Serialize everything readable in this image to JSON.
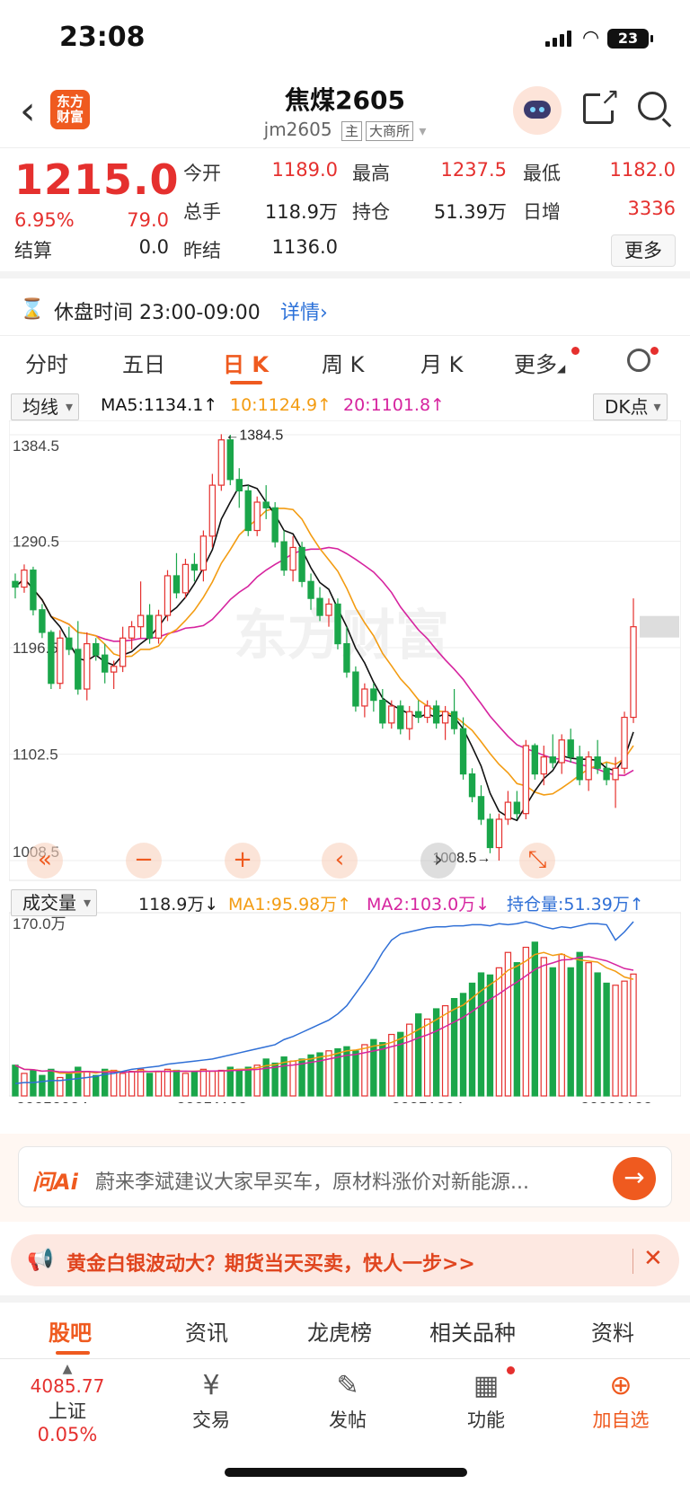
{
  "status": {
    "time": "23:08",
    "battery": "23"
  },
  "header": {
    "logo_text": "东方\n财富",
    "title": "焦煤2605",
    "code": "jm2605",
    "tag_main": "主",
    "tag_exchange": "大商所"
  },
  "quote": {
    "price": "1215.0",
    "change_pct": "6.95%",
    "change_val": "79.0",
    "open_label": "今开",
    "open": "1189.0",
    "high_label": "最高",
    "high": "1237.5",
    "low_label": "最低",
    "low": "1182.0",
    "vol_label": "总手",
    "vol": "118.9万",
    "oi_label": "持仓",
    "oi": "51.39万",
    "daily_inc_label": "日增",
    "daily_inc": "3336",
    "settle_label": "结算",
    "settle": "0.0",
    "prev_settle_label": "昨结",
    "prev_settle": "1136.0",
    "more": "更多"
  },
  "session": {
    "text": "休盘时间 23:00-09:00",
    "link": "详情"
  },
  "tabs": [
    "分时",
    "五日",
    "日 K",
    "周 K",
    "月 K",
    "更多"
  ],
  "indicator": {
    "select": "均线",
    "ma5": "MA5:1134.1↑",
    "ma10": "10:1124.9↑",
    "ma20": "20:1101.8↑",
    "dk": "DK点",
    "y_labels": [
      "1384.5",
      "1290.5",
      "1196.5",
      "1102.5",
      "1008.5"
    ],
    "high_mark": "←1384.5",
    "low_mark": "1008.5→"
  },
  "volume": {
    "select": "成交量",
    "vol": "118.9万↓",
    "ma1": "MA1:95.98万↑",
    "ma2": "MA2:103.0万↓",
    "oi": "持仓量:51.39万↑",
    "ymax": "170.0万",
    "dates": [
      "20250924",
      "20251103",
      "20251204",
      "20260108"
    ]
  },
  "colors": {
    "up": "#e5302e",
    "down": "#1aa64a",
    "ma5": "#111111",
    "ma10": "#f39c12",
    "ma20": "#d6249f",
    "oi": "#2f6fd6",
    "accent": "#ef5a1f"
  },
  "chart_data": {
    "type": "candlestick",
    "title": "焦煤2605 日K",
    "ohlc": [
      [
        1255,
        1262,
        1240,
        1250
      ],
      [
        1250,
        1270,
        1245,
        1265
      ],
      [
        1265,
        1268,
        1225,
        1230
      ],
      [
        1230,
        1235,
        1205,
        1210
      ],
      [
        1210,
        1212,
        1160,
        1165
      ],
      [
        1165,
        1212,
        1160,
        1205
      ],
      [
        1205,
        1215,
        1190,
        1195
      ],
      [
        1195,
        1220,
        1155,
        1160
      ],
      [
        1160,
        1210,
        1150,
        1200
      ],
      [
        1200,
        1205,
        1185,
        1190
      ],
      [
        1190,
        1200,
        1165,
        1175
      ],
      [
        1175,
        1185,
        1160,
        1180
      ],
      [
        1180,
        1215,
        1175,
        1205
      ],
      [
        1205,
        1220,
        1195,
        1215
      ],
      [
        1215,
        1255,
        1205,
        1225
      ],
      [
        1225,
        1235,
        1200,
        1205
      ],
      [
        1205,
        1230,
        1200,
        1225
      ],
      [
        1225,
        1265,
        1220,
        1260
      ],
      [
        1260,
        1280,
        1240,
        1245
      ],
      [
        1245,
        1275,
        1240,
        1270
      ],
      [
        1270,
        1280,
        1255,
        1265
      ],
      [
        1265,
        1300,
        1255,
        1295
      ],
      [
        1295,
        1350,
        1285,
        1340
      ],
      [
        1340,
        1385,
        1335,
        1380
      ],
      [
        1380,
        1384.5,
        1340,
        1345
      ],
      [
        1345,
        1355,
        1320,
        1335
      ],
      [
        1335,
        1340,
        1295,
        1300
      ],
      [
        1300,
        1330,
        1295,
        1325
      ],
      [
        1325,
        1340,
        1310,
        1320
      ],
      [
        1320,
        1325,
        1285,
        1290
      ],
      [
        1290,
        1300,
        1260,
        1265
      ],
      [
        1265,
        1295,
        1255,
        1285
      ],
      [
        1285,
        1290,
        1250,
        1255
      ],
      [
        1255,
        1262,
        1230,
        1240
      ],
      [
        1240,
        1250,
        1220,
        1225
      ],
      [
        1225,
        1240,
        1215,
        1235
      ],
      [
        1235,
        1240,
        1195,
        1200
      ],
      [
        1200,
        1215,
        1170,
        1175
      ],
      [
        1175,
        1180,
        1140,
        1145
      ],
      [
        1145,
        1165,
        1135,
        1160
      ],
      [
        1160,
        1165,
        1140,
        1150
      ],
      [
        1150,
        1160,
        1125,
        1130
      ],
      [
        1130,
        1150,
        1125,
        1145
      ],
      [
        1145,
        1150,
        1120,
        1125
      ],
      [
        1125,
        1145,
        1115,
        1140
      ],
      [
        1140,
        1150,
        1130,
        1135
      ],
      [
        1135,
        1150,
        1130,
        1145
      ],
      [
        1145,
        1150,
        1125,
        1130
      ],
      [
        1130,
        1145,
        1115,
        1140
      ],
      [
        1140,
        1160,
        1120,
        1125
      ],
      [
        1125,
        1135,
        1080,
        1085
      ],
      [
        1085,
        1090,
        1060,
        1065
      ],
      [
        1065,
        1075,
        1040,
        1045
      ],
      [
        1045,
        1050,
        1015,
        1020
      ],
      [
        1020,
        1050,
        1008.5,
        1045
      ],
      [
        1045,
        1070,
        1040,
        1060
      ],
      [
        1060,
        1070,
        1045,
        1050
      ],
      [
        1050,
        1115,
        1045,
        1110
      ],
      [
        1110,
        1112,
        1080,
        1085
      ],
      [
        1085,
        1110,
        1075,
        1100
      ],
      [
        1100,
        1120,
        1090,
        1095
      ],
      [
        1095,
        1120,
        1085,
        1115
      ],
      [
        1115,
        1125,
        1095,
        1100
      ],
      [
        1100,
        1110,
        1075,
        1080
      ],
      [
        1080,
        1105,
        1070,
        1100
      ],
      [
        1100,
        1115,
        1085,
        1090
      ],
      [
        1090,
        1095,
        1075,
        1080
      ],
      [
        1080,
        1100,
        1055,
        1090
      ],
      [
        1090,
        1140,
        1085,
        1135
      ],
      [
        1135,
        1240,
        1130,
        1215
      ]
    ],
    "volume": [
      30,
      22,
      25,
      20,
      26,
      18,
      22,
      28,
      24,
      20,
      26,
      25,
      22,
      24,
      26,
      22,
      24,
      26,
      25,
      22,
      24,
      26,
      24,
      25,
      28,
      26,
      28,
      30,
      36,
      32,
      38,
      34,
      36,
      40,
      42,
      44,
      46,
      48,
      44,
      50,
      55,
      52,
      60,
      62,
      70,
      80,
      75,
      85,
      88,
      95,
      100,
      110,
      120,
      118,
      125,
      140,
      130,
      145,
      150,
      135,
      125,
      138,
      125,
      140,
      130,
      120,
      110,
      108,
      112,
      118.9
    ],
    "open_interest": [
      12,
      13,
      13,
      14,
      15,
      15,
      16,
      17,
      18,
      19,
      21,
      22,
      24,
      26,
      27,
      28,
      29,
      31,
      32,
      33,
      34,
      35,
      36,
      38,
      40,
      42,
      44,
      46,
      48,
      50,
      55,
      58,
      62,
      66,
      70,
      74,
      80,
      88,
      100,
      112,
      125,
      140,
      152,
      158,
      160,
      162,
      164,
      165,
      165,
      166,
      166,
      167,
      167,
      166,
      168,
      167,
      168,
      170,
      168,
      165,
      163,
      165,
      164,
      166,
      168,
      168,
      167,
      152,
      160,
      170
    ]
  }
}
